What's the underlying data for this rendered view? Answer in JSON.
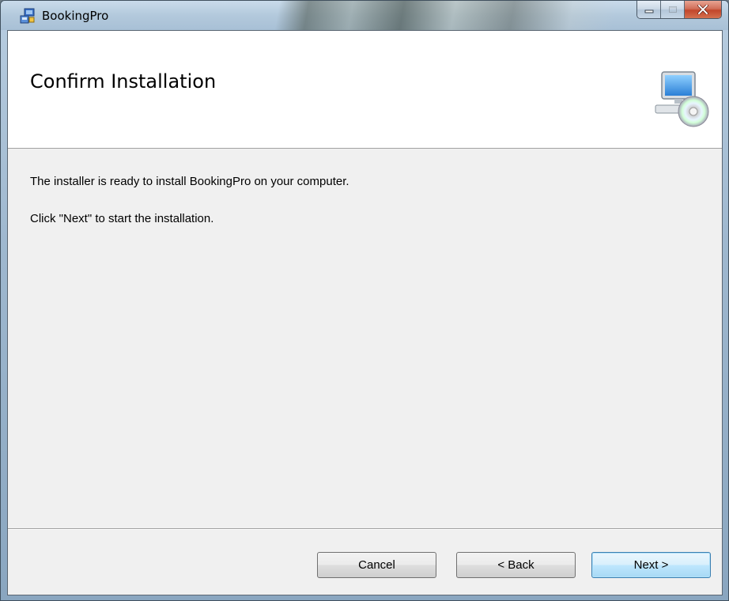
{
  "window": {
    "title": "BookingPro",
    "app_icon": "installer-icon",
    "controls": {
      "minimize": "minimize-icon",
      "maximize": "maximize-icon",
      "close": "close-icon"
    }
  },
  "banner": {
    "title": "Confirm Installation",
    "icon": "computer-cd-icon"
  },
  "content": {
    "line1": "The installer is ready to install BookingPro on your computer.",
    "line2": "Click \"Next\" to start the installation."
  },
  "buttons": {
    "cancel": "Cancel",
    "back": "< Back",
    "next": "Next >"
  },
  "colors": {
    "accent_button": "#bee6fd",
    "close_button": "#c2462b",
    "dialog_background": "#f0f0f0"
  }
}
